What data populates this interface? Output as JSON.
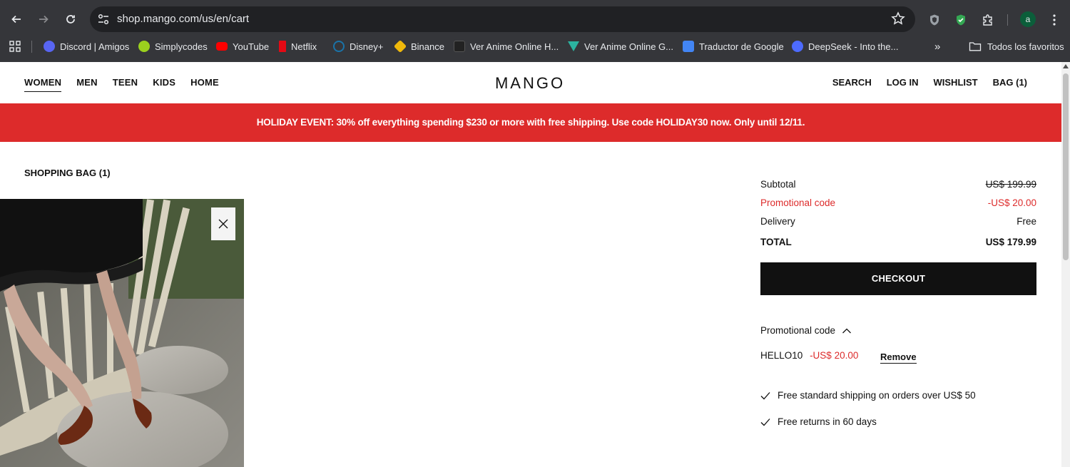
{
  "browser": {
    "url": "shop.mango.com/us/en/cart",
    "bookmarks": [
      {
        "label": "Discord | Amigos",
        "color": "#5865f2"
      },
      {
        "label": "Simplycodes",
        "color": "#9bd11e"
      },
      {
        "label": "YouTube",
        "color": "#ff0000"
      },
      {
        "label": "Netflix",
        "color": "#e50914"
      },
      {
        "label": "Disney+",
        "color": "#1a73a8"
      },
      {
        "label": "Binance",
        "color": "#f0b90b"
      },
      {
        "label": "Ver Anime Online H...",
        "color": "#222222"
      },
      {
        "label": "Ver Anime Online G...",
        "color": "#2bb3a0"
      },
      {
        "label": "Traductor de Google",
        "color": "#4285f4"
      },
      {
        "label": "DeepSeek - Into the...",
        "color": "#4d6bfe"
      }
    ],
    "all_bookmarks_label": "Todos los favoritos",
    "avatar_letter": "a"
  },
  "header": {
    "nav_left": [
      "WOMEN",
      "MEN",
      "TEEN",
      "KIDS",
      "HOME"
    ],
    "logo": "MANGO",
    "nav_right": [
      "SEARCH",
      "LOG IN",
      "WISHLIST",
      "BAG (1)"
    ]
  },
  "banner": {
    "text": "HOLIDAY EVENT: 30% off everything spending $230 or more with free shipping. Use code HOLIDAY30 now. Only until 12/11.",
    "color": "#dd2b2b"
  },
  "bag": {
    "title": "SHOPPING BAG (1)"
  },
  "summary": {
    "subtotal_label": "Subtotal",
    "subtotal_value": "US$ 199.99",
    "promo_label": "Promotional code",
    "promo_value": "-US$ 20.00",
    "delivery_label": "Delivery",
    "delivery_value": "Free",
    "total_label": "TOTAL",
    "total_value": "US$ 179.99",
    "checkout_label": "CHECKOUT"
  },
  "promo": {
    "toggle_label": "Promotional code",
    "code": "HELLO10",
    "discount": "-US$ 20.00",
    "remove_label": "Remove"
  },
  "benefits": [
    "Free standard shipping on orders over US$ 50",
    "Free returns in 60 days"
  ]
}
